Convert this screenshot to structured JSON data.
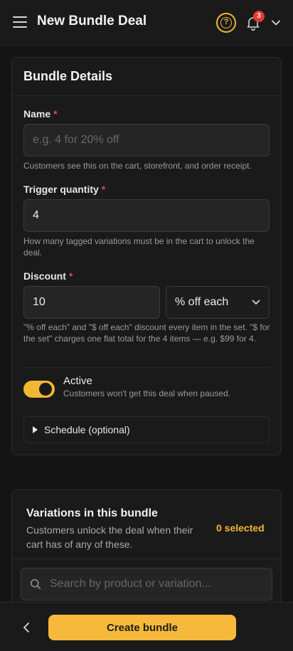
{
  "header": {
    "title": "New Bundle Deal",
    "help_icon": "question-circle-icon",
    "notification_count": "3"
  },
  "bundle_details": {
    "title": "Bundle Details",
    "name": {
      "label": "Name",
      "required_mark": "*",
      "value": "",
      "placeholder": "e.g. 4 for 20% off",
      "help": "Customers see this on the cart, storefront, and order receipt."
    },
    "trigger_quantity": {
      "label": "Trigger quantity",
      "required_mark": "*",
      "value": "4",
      "help": "How many tagged variations must be in the cart to unlock the deal."
    },
    "discount": {
      "label": "Discount",
      "required_mark": "*",
      "value": "10",
      "type_selected": "% off each",
      "help": "\"% off each\" and \"$ off each\" discount every item in the set. \"$ for the set\" charges one flat total for the 4 items — e.g. $99 for 4."
    },
    "active": {
      "label": "Active",
      "help": "Customers won't get this deal when paused."
    },
    "schedule": {
      "label": "Schedule (optional)"
    }
  },
  "variations": {
    "title": "Variations in this bundle",
    "subtitle": "Customers unlock the deal when their cart has of any of these.",
    "selected_count": "0 selected",
    "search": {
      "value": "",
      "placeholder": "Search by product or variation..."
    }
  },
  "footer": {
    "create_label": "Create bundle"
  },
  "colors": {
    "accent": "#f2b733",
    "required": "#e04848",
    "badge": "#e53935",
    "background": "#141414",
    "card": "#1a1a1a"
  }
}
